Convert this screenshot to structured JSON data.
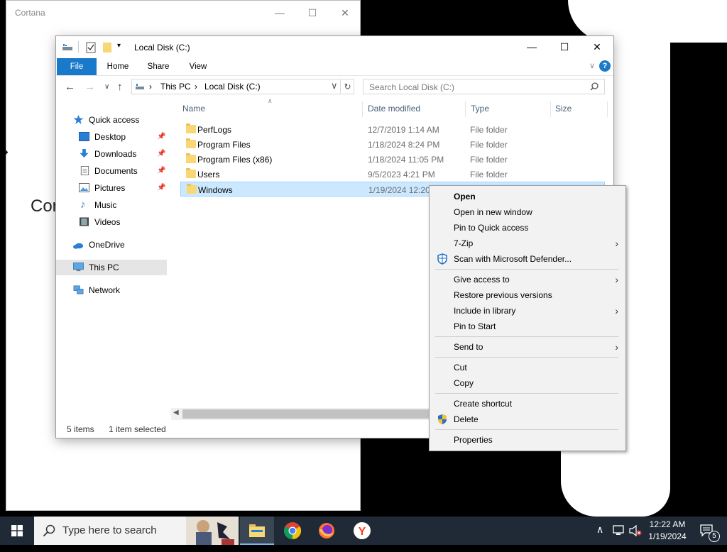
{
  "cortana": {
    "title": "Cortana",
    "big_text": "Cor",
    "controls": {
      "minimize": "—",
      "maximize": "☐",
      "close": "✕"
    }
  },
  "window": {
    "title": "Local Disk (C:)",
    "controls": {
      "minimize": "—",
      "maximize": "☐",
      "close": "✕"
    },
    "ribbon_tabs": [
      "File",
      "Home",
      "Share",
      "View"
    ],
    "help": "?"
  },
  "address": {
    "crumbs": [
      "This PC",
      "Local Disk (C:)"
    ],
    "search_placeholder": "Search Local Disk (C:)"
  },
  "nav": {
    "quick_access": "Quick access",
    "items": [
      {
        "label": "Desktop",
        "icon": "desktop-icon",
        "pinned": true
      },
      {
        "label": "Downloads",
        "icon": "downloads-icon",
        "pinned": true
      },
      {
        "label": "Documents",
        "icon": "documents-icon",
        "pinned": true
      },
      {
        "label": "Pictures",
        "icon": "pictures-icon",
        "pinned": true
      },
      {
        "label": "Music",
        "icon": "music-icon",
        "pinned": false
      },
      {
        "label": "Videos",
        "icon": "videos-icon",
        "pinned": false
      }
    ],
    "onedrive": "OneDrive",
    "this_pc": "This PC",
    "network": "Network"
  },
  "columns": [
    "Name",
    "Date modified",
    "Type",
    "Size"
  ],
  "files": [
    {
      "name": "PerfLogs",
      "date": "12/7/2019 1:14 AM",
      "type": "File folder"
    },
    {
      "name": "Program Files",
      "date": "1/18/2024 8:24 PM",
      "type": "File folder"
    },
    {
      "name": "Program Files (x86)",
      "date": "1/18/2024 11:05 PM",
      "type": "File folder"
    },
    {
      "name": "Users",
      "date": "9/5/2023 4:21 PM",
      "type": "File folder"
    },
    {
      "name": "Windows",
      "date": "1/19/2024 12:20",
      "type": "",
      "selected": true
    }
  ],
  "status": {
    "items": "5 items",
    "selected": "1 item selected"
  },
  "context_menu": {
    "open": "Open",
    "open_new_window": "Open in new window",
    "pin_quick_access": "Pin to Quick access",
    "seven_zip": "7-Zip",
    "scan_defender": "Scan with Microsoft Defender...",
    "give_access": "Give access to",
    "restore_versions": "Restore previous versions",
    "include_library": "Include in library",
    "pin_start": "Pin to Start",
    "send_to": "Send to",
    "cut": "Cut",
    "copy": "Copy",
    "create_shortcut": "Create shortcut",
    "delete": "Delete",
    "properties": "Properties"
  },
  "taskbar": {
    "search_placeholder": "Type here to search",
    "time": "12:22 AM",
    "date": "1/19/2024",
    "notification_count": "5"
  },
  "colors": {
    "accent": "#1979ca",
    "selection": "#cce8ff",
    "taskbar": "#1f2a36"
  }
}
